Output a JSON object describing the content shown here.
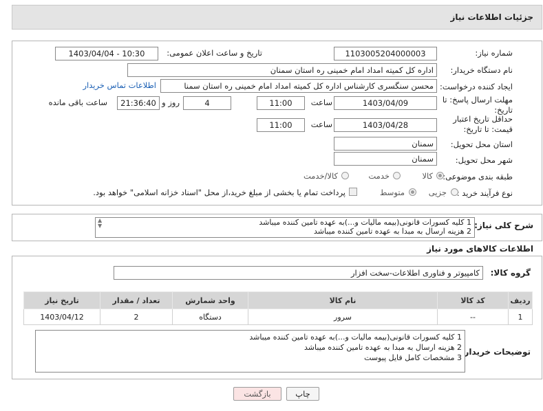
{
  "header": {
    "title": "جزئیات اطلاعات نیاز"
  },
  "form": {
    "need_number_label": "شماره نیاز:",
    "need_number": "1103005204000003",
    "announce_label": "تاریخ و ساعت اعلان عمومی:",
    "announce_value": "1403/04/04 - 10:30",
    "buyer_org_label": "نام دستگاه خریدار:",
    "buyer_org": "اداره کل کمیته امداد امام خمینی  ره  استان سمنان",
    "creator_label": "ایجاد کننده درخواست:",
    "creator": "محسن  سنگسری کارشناس اداره کل کمیته امداد امام خمینی  ره  استان سمنا",
    "contact_link": "اطلاعات تماس خریدار",
    "deadline_label": "مهلت ارسال پاسخ: تا تاریخ:",
    "deadline_date": "1403/04/09",
    "time_label": "ساعت",
    "deadline_time": "11:00",
    "days_value": "4",
    "days_label": "روز و",
    "remaining_time": "21:36:40",
    "remaining_label": "ساعت باقی مانده",
    "validity_label": "حداقل تاریخ اعتبار قیمت: تا تاریخ:",
    "validity_date": "1403/04/28",
    "validity_time": "11:00",
    "province_label": "استان محل تحویل:",
    "province": "سمنان",
    "city_label": "شهر محل تحویل:",
    "city": "سمنان",
    "category_label": "طبقه بندی موضوعی:",
    "category_options": [
      "کالا",
      "خدمت",
      "کالا/خدمت"
    ],
    "process_label": "نوع فرآیند خرید :",
    "process_options": [
      "جزیی",
      "متوسط"
    ],
    "payment_note": "پرداخت تمام یا بخشی از مبلغ خرید،از محل \"اسناد خزانه اسلامی\" خواهد بود."
  },
  "summary": {
    "label": "شرح کلی نیاز:",
    "lines": [
      "1 کلیه کسورات قانونی(بیمه مالیات و...)به عهده تامین کننده میباشد",
      "2 هزینه ارسال به مبدا به عهده تامین کننده میباشد"
    ]
  },
  "goods": {
    "section_title": "اطلاعات کالاهای مورد نیاز",
    "group_label": "گروه کالا:",
    "group_value": "کامپیوتر و فناوری اطلاعات-سخت افزار",
    "table": {
      "headers": [
        "ردیف",
        "کد کالا",
        "نام کالا",
        "واحد شمارش",
        "تعداد / مقدار",
        "تاریخ نیاز"
      ],
      "rows": [
        [
          "1",
          "--",
          "سرور",
          "دستگاه",
          "2",
          "1403/04/12"
        ]
      ]
    }
  },
  "buyer_notes": {
    "label": "توضیحات خریدار:",
    "lines": [
      "1 کلیه کسورات قانونی(بیمه مالیات و...)به عهده تامین کننده میباشد",
      "2 هزینه ارسال به مبدا به عهده تامین کننده میباشد",
      "3 مشخصات کامل فایل پیوست"
    ]
  },
  "buttons": {
    "print": "چاپ",
    "back": "بازگشت"
  },
  "colors": {
    "header_bg": "#e4e4e4",
    "link": "#1a5fb4",
    "back_bg": "#fbe4e4",
    "table_header": "#d6d6d6"
  }
}
